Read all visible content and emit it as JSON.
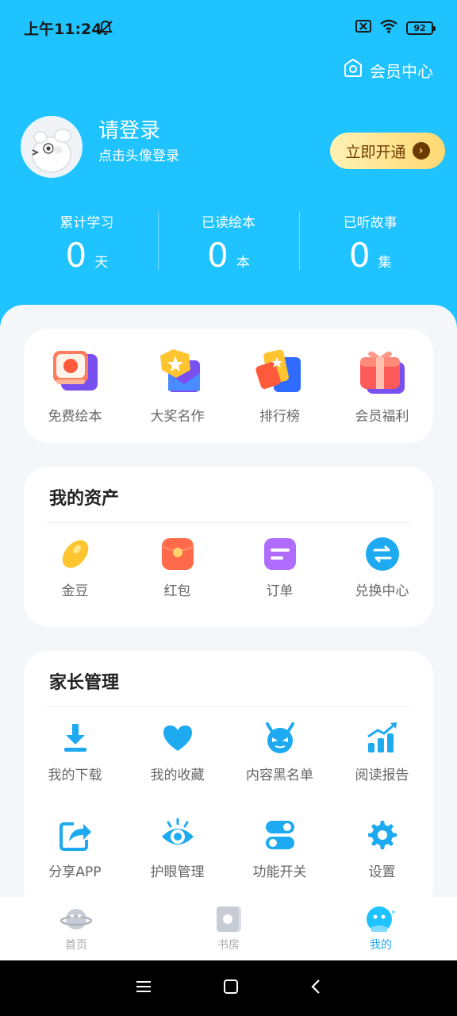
{
  "status_bar": {
    "time": "上午11:24",
    "battery": "92"
  },
  "header": {
    "member_center_label": "会员中心"
  },
  "profile": {
    "login_title": "请登录",
    "login_subtitle": "点击头像登录",
    "vip_button_label": "立即开通"
  },
  "stats": [
    {
      "label": "累计学习",
      "value": "0",
      "unit": "天"
    },
    {
      "label": "已读绘本",
      "value": "0",
      "unit": "本"
    },
    {
      "label": "已听故事",
      "value": "0",
      "unit": "集"
    }
  ],
  "quick_entries": [
    {
      "label": "免费绘本",
      "icon": "free-book-icon"
    },
    {
      "label": "大奖名作",
      "icon": "award-star-icon"
    },
    {
      "label": "排行榜",
      "icon": "ranking-icon"
    },
    {
      "label": "会员福利",
      "icon": "gift-icon"
    }
  ],
  "assets": {
    "title": "我的资产",
    "items": [
      {
        "label": "金豆",
        "icon": "gold-bean-icon"
      },
      {
        "label": "红包",
        "icon": "red-packet-icon"
      },
      {
        "label": "订单",
        "icon": "order-icon"
      },
      {
        "label": "兑换中心",
        "icon": "exchange-icon"
      }
    ]
  },
  "parent": {
    "title": "家长管理",
    "items": [
      {
        "label": "我的下载",
        "icon": "download-icon"
      },
      {
        "label": "我的收藏",
        "icon": "heart-icon"
      },
      {
        "label": "内容黑名单",
        "icon": "devil-icon"
      },
      {
        "label": "阅读报告",
        "icon": "chart-icon"
      },
      {
        "label": "分享APP",
        "icon": "share-icon"
      },
      {
        "label": "护眼管理",
        "icon": "eye-icon"
      },
      {
        "label": "功能开关",
        "icon": "toggle-icon"
      },
      {
        "label": "设置",
        "icon": "gear-icon"
      }
    ]
  },
  "bottom_nav": [
    {
      "label": "首页",
      "icon": "planet-icon",
      "active": false
    },
    {
      "label": "书房",
      "icon": "book-icon",
      "active": false
    },
    {
      "label": "我的",
      "icon": "mascot-icon",
      "active": true
    }
  ],
  "colors": {
    "header_bg": "#1ec3ff",
    "accent": "#1eaaf0",
    "vip_gold": "#ffd872"
  }
}
